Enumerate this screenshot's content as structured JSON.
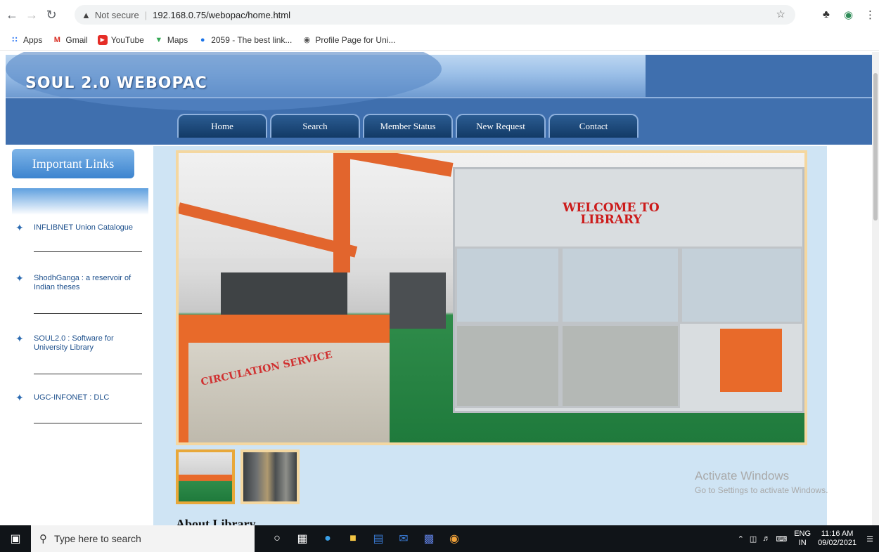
{
  "browser": {
    "security_label": "Not secure",
    "url": "192.168.0.75/webopac/home.html",
    "bookmarks": [
      "Apps",
      "Gmail",
      "YouTube",
      "Maps",
      "2059 - The best link...",
      "Profile Page for Uni..."
    ]
  },
  "site": {
    "logo": "SOUL 2.0 WEBOPAC",
    "menu": [
      "Home",
      "Search",
      "Member Status",
      "New Request",
      "Contact"
    ]
  },
  "sidebar": {
    "title": "Important Links",
    "links": [
      "INFLIBNET Union Catalogue",
      "ShodhGanga : a reservoir of Indian theses",
      "SOUL2.0 : Software for University Library",
      "UGC-INFONET : DLC"
    ]
  },
  "gallery": {
    "welcome_sign": "WELCOME TO LIBRARY",
    "counter_sign": "CIRCULATION SERVICE"
  },
  "about_heading": "About Library",
  "watermark": {
    "title": "Activate Windows",
    "subtitle": "Go to Settings to activate Windows."
  },
  "taskbar": {
    "search_placeholder": "Type here to search",
    "lang": "ENG",
    "region": "IN",
    "time": "11:16 AM",
    "date": "09/02/2021"
  },
  "colors": {
    "header_blue": "#3f6fae",
    "menu_dark": "#123a66",
    "content_bg": "#cfe4f4",
    "frame": "#f4d7a0"
  }
}
